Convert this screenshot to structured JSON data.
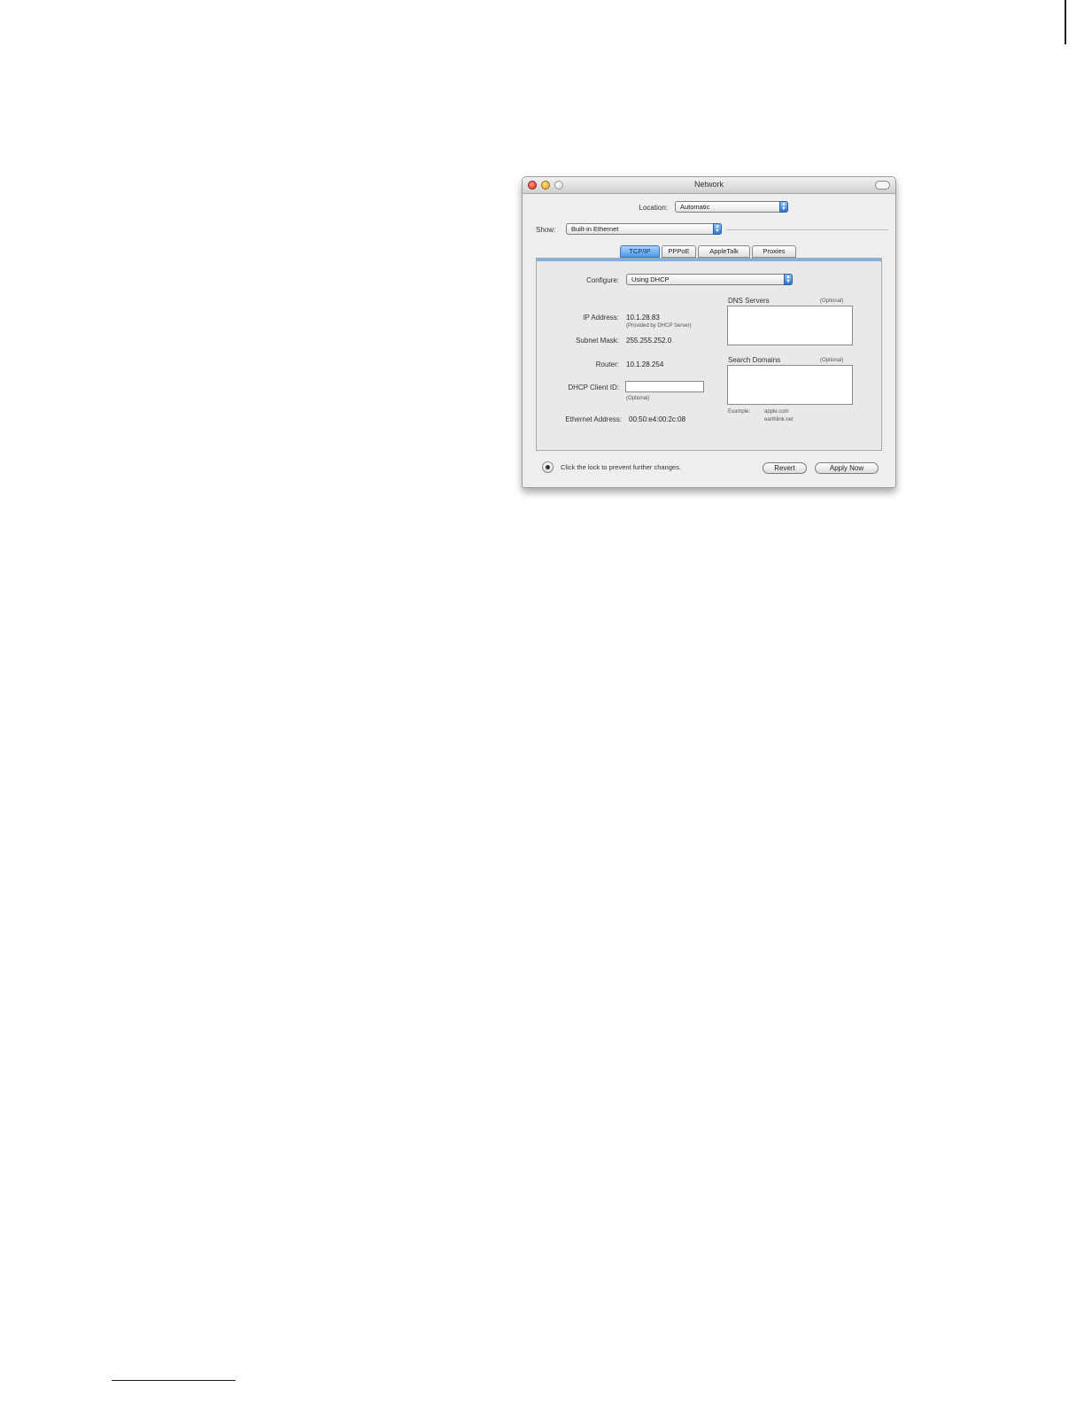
{
  "window": {
    "title": "Network",
    "location": {
      "label": "Location:",
      "value": "Automatic"
    },
    "show": {
      "label": "Show:",
      "value": "Built-in Ethernet"
    },
    "tabs": [
      {
        "label": "TCP/IP",
        "active": true
      },
      {
        "label": "PPPoE",
        "active": false
      },
      {
        "label": "AppleTalk",
        "active": false
      },
      {
        "label": "Proxies",
        "active": false
      }
    ],
    "tcpip": {
      "configure": {
        "label": "Configure:",
        "value": "Using DHCP"
      },
      "ip_address": {
        "label": "IP Address:",
        "value": "10.1.28.83",
        "note": "(Provided by DHCP Server)"
      },
      "subnet_mask": {
        "label": "Subnet Mask:",
        "value": "255.255.252.0"
      },
      "router": {
        "label": "Router:",
        "value": "10.1.28.254"
      },
      "dhcp_client_id": {
        "label": "DHCP Client ID:",
        "value": "",
        "note": "(Optional)"
      },
      "ethernet_address": {
        "label": "Ethernet Address:",
        "value": "00:50:e4:00:2c:08"
      },
      "dns_servers": {
        "label": "DNS Servers",
        "optional": "(Optional)"
      },
      "search_domains": {
        "label": "Search Domains",
        "optional": "(Optional)"
      },
      "example": {
        "label": "Example:",
        "line1": "apple.com",
        "line2": "earthlink.net"
      }
    },
    "footer": {
      "lock_text": "Click the lock to prevent further changes.",
      "revert_label": "Revert",
      "apply_label": "Apply Now"
    }
  },
  "colors": {
    "accent": "#4c97e6",
    "window_bg": "#eeeeee"
  },
  "icons": [
    "close-button-icon",
    "minimize-button-icon",
    "zoom-button-icon",
    "toolbar-toggle-icon",
    "lock-icon",
    "popup-arrows-icon"
  ]
}
